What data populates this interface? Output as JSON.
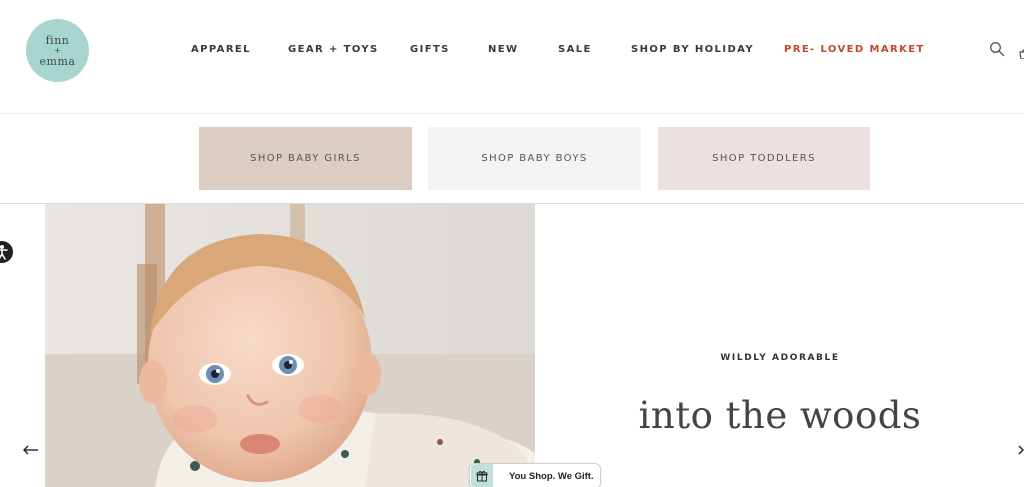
{
  "brand": {
    "logo_line1": "finn",
    "logo_line2": "+",
    "logo_line3": "emma",
    "logo_color": "#a8d6ce"
  },
  "nav": {
    "items": [
      {
        "label": "APPAREL"
      },
      {
        "label": "GEAR + TOYS"
      },
      {
        "label": "GIFTS"
      },
      {
        "label": "NEW"
      },
      {
        "label": "SALE"
      },
      {
        "label": "SHOP BY HOLIDAY"
      },
      {
        "label": "PRE- LOVED MARKET"
      }
    ],
    "accent_color": "#c3482a",
    "icons": [
      "search-icon",
      "cart-icon"
    ]
  },
  "categories": [
    {
      "label": "SHOP BABY GIRLS",
      "color": "#dcccc2"
    },
    {
      "label": "SHOP BABY BOYS",
      "color": "#f4f3f1"
    },
    {
      "label": "SHOP TODDLERS",
      "color": "#ebe1de"
    }
  ],
  "hero": {
    "eyebrow": "WILDLY ADORABLE",
    "title": "into the woods",
    "image_icon": "baby-photo",
    "prev_icon": "arrow-left-icon",
    "next_icon": "arrow-right-icon"
  },
  "accessibility": {
    "icon": "accessibility-icon"
  },
  "gift_widget": {
    "label": "You Shop. We Gift.",
    "icon": "gift-icon"
  }
}
